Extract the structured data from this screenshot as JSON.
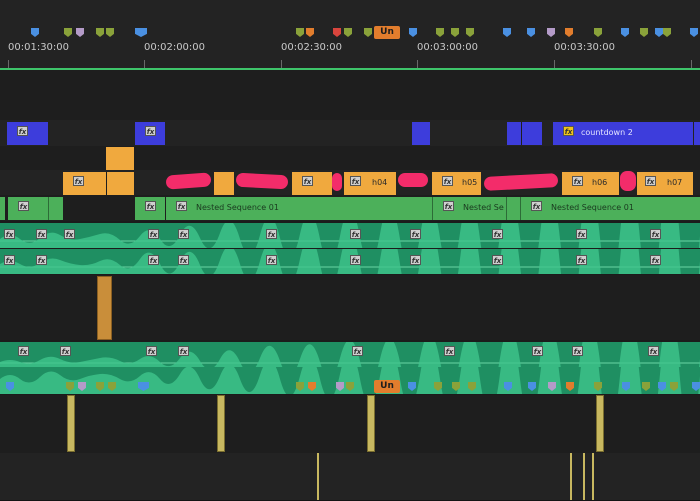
{
  "ruler": {
    "timecodes": [
      "00:01:30:00",
      "00:02:00:00",
      "00:02:30:00",
      "00:03:00:00",
      "00:03:30:00"
    ],
    "current_marker_label": "Un"
  },
  "colors": {
    "marker_blue": "#4a90e2",
    "marker_olive": "#8aa23a",
    "marker_lavender": "#b49bc8",
    "marker_orange": "#e27d2d",
    "marker_red": "#d9453d",
    "clip_video_blue": "#3d3ddc",
    "clip_orange": "#f0a93e",
    "clip_green": "#4cb05a",
    "clip_audio": "#1f8f62",
    "clip_adjust": "#c8b860",
    "playline": "#3ec46a"
  },
  "clips": {
    "countdown_label": "countdown 2",
    "h04": "h04",
    "h05": "h05",
    "h06": "h06",
    "h07": "h07",
    "nested_1": "Nested Sequence 01",
    "nested_2": "Nested Se",
    "nested_3": "Nested Sequence 01",
    "fx": "fx"
  },
  "audio_marker_label": "Un"
}
